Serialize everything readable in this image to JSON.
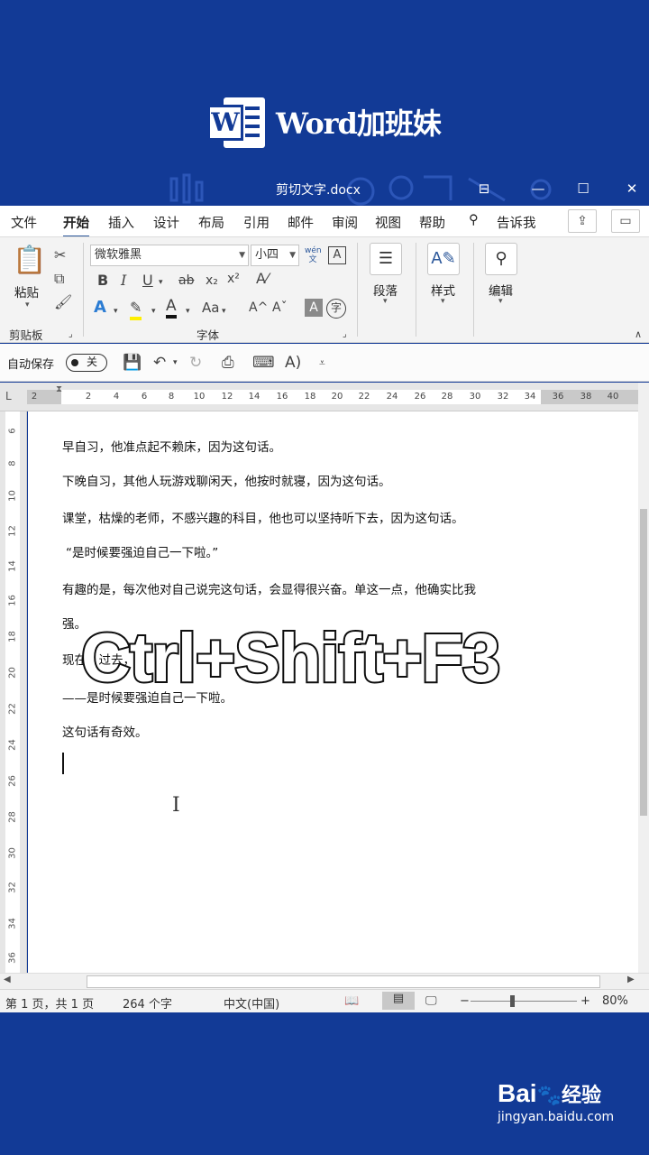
{
  "brand": {
    "logo_letter": "W",
    "title": "Word加班妹"
  },
  "window": {
    "title": "剪切文字.docx",
    "buttons": [
      "⊟",
      "—",
      "☐",
      "✕"
    ]
  },
  "menu": {
    "tabs": [
      "文件",
      "开始",
      "插入",
      "设计",
      "布局",
      "引用",
      "邮件",
      "审阅",
      "视图",
      "帮助"
    ],
    "active_tab": "开始",
    "tell_me": "告诉我"
  },
  "ribbon": {
    "clipboard": {
      "paste_label": "粘贴",
      "group_label": "剪贴板"
    },
    "font": {
      "font_name": "微软雅黑",
      "font_size": "小四",
      "wen_label": "wén 文",
      "group_label": "字体"
    },
    "paragraph": {
      "label": "段落"
    },
    "styles": {
      "label": "样式"
    },
    "editing": {
      "label": "编辑"
    }
  },
  "qat": {
    "autosave_label": "自动保存",
    "toggle_state": "关"
  },
  "ruler": {
    "numbers": [
      "2",
      "2",
      "4",
      "6",
      "8",
      "10",
      "12",
      "14",
      "16",
      "18",
      "20",
      "22",
      "24",
      "26",
      "28",
      "30",
      "32",
      "34",
      "36",
      "38",
      "40"
    ],
    "vertical_numbers": [
      "6",
      "8",
      "10",
      "12",
      "14",
      "16",
      "18",
      "20",
      "22",
      "24",
      "26",
      "28",
      "30",
      "32",
      "34",
      "36"
    ]
  },
  "document": {
    "lines": [
      "早自习，他准点起不赖床，因为这句话。",
      "下晚自习，其他人玩游戏聊闲天，他按时就寝，因为这句话。",
      "课堂，枯燥的老师，不感兴趣的科目，他也可以坚持听下去，因为这句话。",
      "“是时候要强迫自己一下啦。”",
      "有趣的是，每次他对自己说完这句话，会显得很兴奋。单这一点，他确实比我",
      "强。",
      "现在，过去，",
      "——是时候要强迫自己一下啦。",
      "这句话有奇效。"
    ]
  },
  "status": {
    "page": "第 1 页，共 1 页",
    "words": "264 个字",
    "language": "中文(中国)",
    "zoom": "80%"
  },
  "overlay": {
    "shortcut": "Ctrl+Shift+F3"
  },
  "watermark": {
    "logo": "Bai",
    "logo_suffix": "经验",
    "url": "jingyan.baidu.com"
  },
  "colors": {
    "brand_blue": "#123a96",
    "word_blue": "#2b579a"
  }
}
